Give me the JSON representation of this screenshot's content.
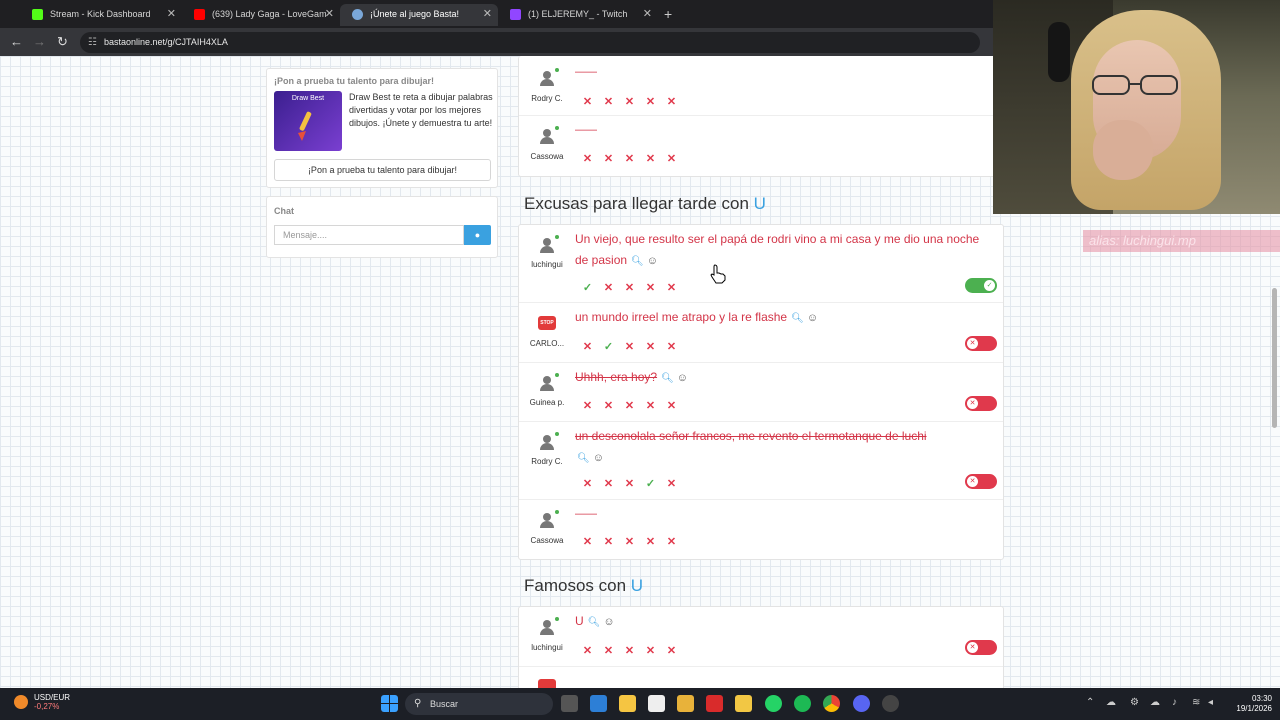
{
  "browser": {
    "tabs": [
      {
        "title": "Stream - Kick Dashboard",
        "icon": "kick-icon",
        "color": "#53fc18",
        "active": false
      },
      {
        "title": "(639) Lady Gaga - LoveGam",
        "icon": "youtube-icon",
        "color": "#ff0000",
        "active": false
      },
      {
        "title": "¡Únete al juego Basta!",
        "icon": "globe-icon",
        "color": "#7aa7d8",
        "active": true
      },
      {
        "title": "(1) ELJEREMY_ - Twitch",
        "icon": "twitch-icon",
        "color": "#9146ff",
        "active": false
      }
    ],
    "new_tab": "+",
    "url": "bastaonline.net/g/CJTAIH4XLA"
  },
  "promo": {
    "header": "¡Pon a prueba tu talento para dibujar!",
    "image_title": "Draw Best",
    "text": "Draw Best te reta a dibujar palabras divertidas y votar por los mejores dibujos. ¡Únete y demuestra tu arte!",
    "button": "¡Pon a prueba tu talento para dibujar!"
  },
  "chat": {
    "title": "Chat",
    "placeholder": "Mensaje....",
    "send_icon": "chat-bubble-icon"
  },
  "top_rows": [
    {
      "user": "Rodry C.",
      "answer": "——",
      "votes": [
        "no",
        "no",
        "no",
        "no",
        "no"
      ]
    },
    {
      "user": "Cassowa",
      "answer": "——",
      "votes": [
        "no",
        "no",
        "no",
        "no",
        "no"
      ]
    }
  ],
  "section1": {
    "title": "Excusas para llegar tarde con",
    "letter": "U",
    "rows": [
      {
        "user": "luchingui",
        "answer": "Un viejo, que resulto ser el papá de rodri vino a mi casa y me dio una noche de pasion",
        "struck": false,
        "votes": [
          "yes",
          "no",
          "no",
          "no",
          "no"
        ],
        "toggle": "on"
      },
      {
        "user": "CARLO...",
        "answer": "un mundo irreel me atrapo y la re flashe",
        "struck": false,
        "votes": [
          "no",
          "yes",
          "no",
          "no",
          "no"
        ],
        "toggle": "off",
        "stop": true
      },
      {
        "user": "Guinea p.",
        "answer": "Uhhh, era hoy?",
        "struck": true,
        "votes": [
          "no",
          "no",
          "no",
          "no",
          "no"
        ],
        "toggle": "off"
      },
      {
        "user": "Rodry C.",
        "answer": "un desconolala señor francos, me revento el termotanque de luchi",
        "struck": true,
        "votes": [
          "no",
          "no",
          "no",
          "yes",
          "no"
        ],
        "toggle": "off"
      },
      {
        "user": "Cassowa",
        "answer": "——",
        "struck": false,
        "votes": [
          "no",
          "no",
          "no",
          "no",
          "no"
        ],
        "toggle": null
      }
    ]
  },
  "section2": {
    "title": "Famosos con",
    "letter": "U",
    "rows": [
      {
        "user": "luchingui",
        "answer": "U",
        "votes": [
          "no",
          "no",
          "no",
          "no",
          "no"
        ],
        "toggle": "off"
      }
    ]
  },
  "stop_badge": "STOP",
  "overlay_text": "alias: luchingui.mp",
  "taskbar": {
    "ticker_name": "USD/EUR",
    "ticker_value": "-0,27%",
    "search": "Buscar",
    "time": "03:30",
    "date": "19/1/2026"
  }
}
